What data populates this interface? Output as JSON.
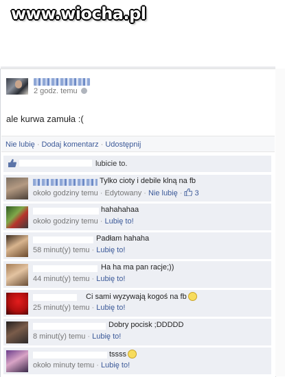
{
  "watermark": "www.wiocha.pl",
  "post": {
    "time": "2 godz. temu",
    "text": "ale kurwa zamuła :(",
    "actions": [
      "Nie lubię",
      "Dodaj komentarz",
      "Udostępnij"
    ]
  },
  "likes": {
    "text": "lubicie to."
  },
  "comments": [
    {
      "text": "Tylko cioty i debile klną na fb",
      "time": "około godziny temu",
      "extra": "Edytowany",
      "like_label": "Nie lubię",
      "like_count": "3"
    },
    {
      "text": "hahahahaa",
      "time": "około godziny temu",
      "like_label": "Lubię to!"
    },
    {
      "text": "Padłam hahaha",
      "time": "58 minut(y) temu",
      "like_label": "Lubię to!"
    },
    {
      "text": "Ha ha ma pan racje;))",
      "time": "44 minut(y) temu",
      "like_label": "Lubię to!"
    },
    {
      "text": "Ci sami wyzywają kogoś na fb",
      "time": "25 minut(y) temu",
      "like_label": "Lubię to!"
    },
    {
      "text": "Dobry pocisk ;DDDDD",
      "time": "8 minut(y) temu",
      "like_label": "Lubię to!"
    },
    {
      "text": "tssss",
      "time": "około minuty temu",
      "like_label": "Lubię to!"
    }
  ]
}
